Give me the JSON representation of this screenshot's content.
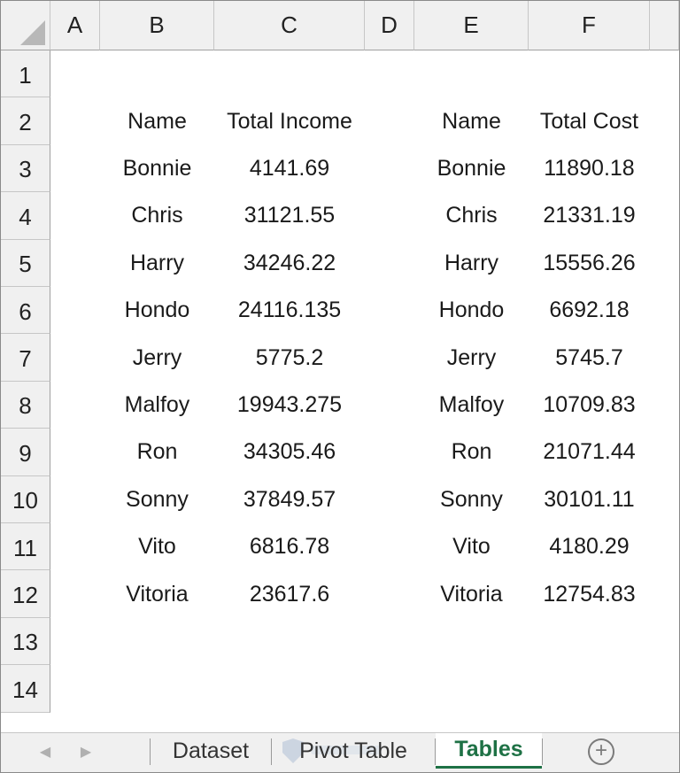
{
  "columns": [
    "A",
    "B",
    "C",
    "D",
    "E",
    "F"
  ],
  "rows": [
    "1",
    "2",
    "3",
    "4",
    "5",
    "6",
    "7",
    "8",
    "9",
    "10",
    "11",
    "12",
    "13",
    "14"
  ],
  "table1": {
    "headers": [
      "Name",
      "Total Income"
    ],
    "data": [
      [
        "Bonnie",
        "4141.69"
      ],
      [
        "Chris",
        "31121.55"
      ],
      [
        "Harry",
        "34246.22"
      ],
      [
        "Hondo",
        "24116.135"
      ],
      [
        "Jerry",
        "5775.2"
      ],
      [
        "Malfoy",
        "19943.275"
      ],
      [
        "Ron",
        "34305.46"
      ],
      [
        "Sonny",
        "37849.57"
      ],
      [
        "Vito",
        "6816.78"
      ],
      [
        "Vitoria",
        "23617.6"
      ]
    ]
  },
  "table2": {
    "headers": [
      "Name",
      "Total Cost"
    ],
    "data": [
      [
        "Bonnie",
        "11890.18"
      ],
      [
        "Chris",
        "21331.19"
      ],
      [
        "Harry",
        "15556.26"
      ],
      [
        "Hondo",
        "6692.18"
      ],
      [
        "Jerry",
        "5745.7"
      ],
      [
        "Malfoy",
        "10709.83"
      ],
      [
        "Ron",
        "21071.44"
      ],
      [
        "Sonny",
        "30101.11"
      ],
      [
        "Vito",
        "4180.29"
      ],
      [
        "Vitoria",
        "12754.83"
      ]
    ]
  },
  "sheet_tabs": [
    {
      "label": "Dataset",
      "active": false
    },
    {
      "label": "Pivot Table",
      "active": false
    },
    {
      "label": "Tables",
      "active": true
    }
  ],
  "add_sheet_label": "+",
  "accent_color": "#1e7145"
}
